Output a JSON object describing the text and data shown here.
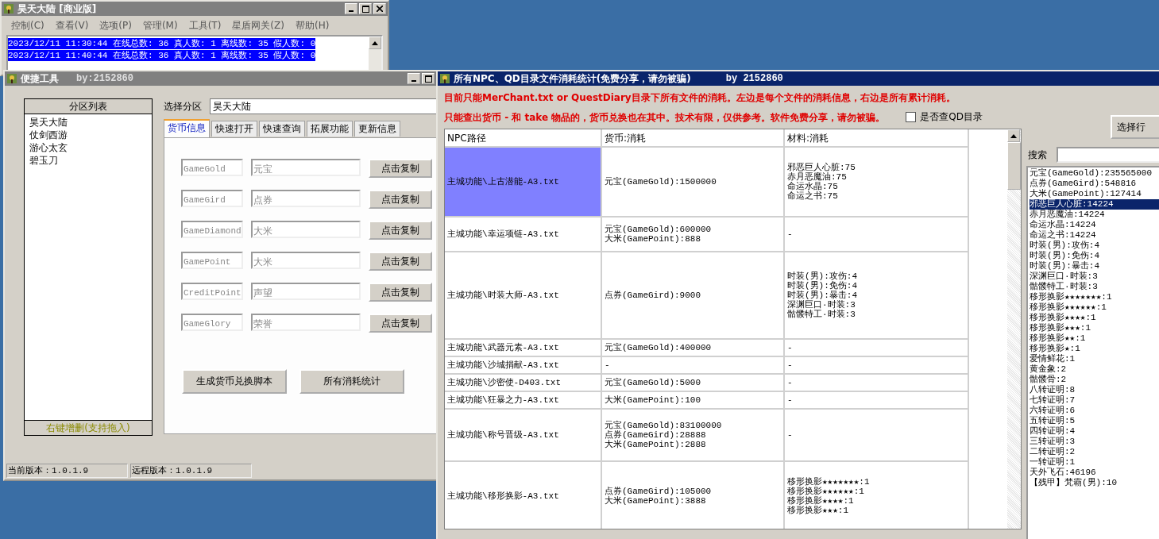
{
  "main_window": {
    "title": "昊天大陆 [商业版]",
    "menu": [
      "控制(C)",
      "查看(V)",
      "选项(P)",
      "管理(M)",
      "工具(T)",
      "星盾网关(Z)",
      "帮助(H)"
    ],
    "log": [
      {
        "text": "2023/12/11 11:30:44 在线总数: 36 真人数: 1 离线数: 35 假人数: 0",
        "selected": true
      },
      {
        "text": "2023/12/11 11:40:44 在线总数: 36 真人数: 1 离线数: 35 假人数: 0",
        "selected": true
      }
    ]
  },
  "tool_window": {
    "title": "便捷工具",
    "author": "by:2152860",
    "partition_list": {
      "header": "分区列表",
      "items": [
        {
          "label": "昊天大陆",
          "selected": false
        },
        {
          "label": "仗剑西游",
          "selected": false
        },
        {
          "label": "游心太玄",
          "selected": false
        },
        {
          "label": "碧玉刀",
          "selected": false
        }
      ],
      "footer": "右键增删(支持拖入)"
    },
    "partition_label": "选择分区",
    "partition_value": "昊天大陆",
    "tabs": [
      {
        "label": "货币信息",
        "selected": true
      },
      {
        "label": "快速打开",
        "selected": false
      },
      {
        "label": "快速查询",
        "selected": false
      },
      {
        "label": "拓展功能",
        "selected": false
      },
      {
        "label": "更新信息",
        "selected": false
      }
    ],
    "currency_rows": [
      {
        "key": "GameGold",
        "name": "元宝",
        "button": "点击复制"
      },
      {
        "key": "GameGird",
        "name": "点券",
        "button": "点击复制"
      },
      {
        "key": "GameDiamond",
        "name": "大米",
        "button": "点击复制"
      },
      {
        "key": "GamePoint",
        "name": "大米",
        "button": "点击复制"
      },
      {
        "key": "CreditPoint",
        "name": "声望",
        "button": "点击复制"
      },
      {
        "key": "GameGlory",
        "name": "荣誉",
        "button": "点击复制"
      }
    ],
    "actions": [
      "生成货币兑换脚本",
      "所有消耗统计"
    ],
    "status": [
      "当前版本：1.0.1.9",
      "远程版本：1.0.1.9"
    ]
  },
  "stats_window": {
    "title": "所有NPC、QD目录文件消耗统计(免费分享，请勿被骗)",
    "author": "by 2152860",
    "notices": [
      "目前只能MerChant.txt or QuestDiary目录下所有文件的消耗。左边是每个文件的消耗信息，右边是所有累计消耗。",
      "只能查出货币 - 和 take 物品的，货币兑换也在其中。技术有限，仅供参考。软件免费分享，请勿被骗。"
    ],
    "qd_checkbox": {
      "label": "是否查QD目录",
      "checked": false
    },
    "select_button": "选择行",
    "table": {
      "columns": [
        "NPC路径",
        "货币:消耗",
        "材料:消耗"
      ],
      "rows": [
        {
          "path": "主城功能\\上古潜能-A3.txt",
          "selected": true,
          "currency": [
            "元宝(GameGold):1500000"
          ],
          "materials": [
            "邪恶巨人心脏:75",
            "赤月恶魔油:75",
            "命运水晶:75",
            "命运之书:75"
          ]
        },
        {
          "path": "主城功能\\幸运项链-A3.txt",
          "selected": false,
          "currency": [
            "元宝(GameGold):600000",
            "大米(GamePoint):888"
          ],
          "materials": [
            "-"
          ]
        },
        {
          "path": "主城功能\\时装大师-A3.txt",
          "selected": false,
          "currency": [
            "点券(GameGird):9000"
          ],
          "materials": [
            "时装(男):攻伤:4",
            "时装(男):免伤:4",
            "时装(男):暴击:4",
            "深渊巨口·时装:3",
            "骷髅特工·时装:3"
          ]
        },
        {
          "path": "主城功能\\武器元素-A3.txt",
          "selected": false,
          "currency": [
            "元宝(GameGold):400000"
          ],
          "materials": [
            "-"
          ]
        },
        {
          "path": "主城功能\\沙城捐献-A3.txt",
          "selected": false,
          "currency": [
            "-"
          ],
          "materials": [
            "-"
          ]
        },
        {
          "path": "主城功能\\沙密使-D403.txt",
          "selected": false,
          "currency": [
            "元宝(GameGold):5000"
          ],
          "materials": [
            "-"
          ]
        },
        {
          "path": "主城功能\\狂暴之力-A3.txt",
          "selected": false,
          "currency": [
            "大米(GamePoint):100"
          ],
          "materials": [
            "-"
          ]
        },
        {
          "path": "主城功能\\称号晋级-A3.txt",
          "selected": false,
          "currency": [
            "元宝(GameGold):83100000",
            "点券(GameGird):28888",
            "大米(GamePoint):2888"
          ],
          "materials": [
            "-"
          ]
        },
        {
          "path": "主城功能\\移形换影-A3.txt",
          "selected": false,
          "currency": [
            "点券(GameGird):105000",
            "大米(GamePoint):3888"
          ],
          "materials": [
            "移形换影★★★★★★★:1",
            "移形换影★★★★★★:1",
            "移形换影★★★★:1",
            "移形换影★★★:1"
          ]
        }
      ]
    },
    "search": {
      "label": "搜索"
    },
    "totals": [
      {
        "text": "元宝(GameGold):235565000",
        "selected": false
      },
      {
        "text": "点券(GameGird):548816",
        "selected": false
      },
      {
        "text": "大米(GamePoint):127414",
        "selected": false
      },
      {
        "text": "邪恶巨人心脏:14224",
        "selected": true
      },
      {
        "text": "赤月恶魔油:14224",
        "selected": false
      },
      {
        "text": "命运水晶:14224",
        "selected": false
      },
      {
        "text": "命运之书:14224",
        "selected": false
      },
      {
        "text": "时装(男):攻伤:4",
        "selected": false
      },
      {
        "text": "时装(男):免伤:4",
        "selected": false
      },
      {
        "text": "时装(男):暴击:4",
        "selected": false
      },
      {
        "text": "深渊巨口·时装:3",
        "selected": false
      },
      {
        "text": "骷髅特工·时装:3",
        "selected": false
      },
      {
        "text": "移形换影★★★★★★★:1",
        "selected": false
      },
      {
        "text": "移形换影★★★★★★:1",
        "selected": false
      },
      {
        "text": "移形换影★★★★:1",
        "selected": false
      },
      {
        "text": "移形换影★★★:1",
        "selected": false
      },
      {
        "text": "移形换影★★:1",
        "selected": false
      },
      {
        "text": "移形换影★:1",
        "selected": false
      },
      {
        "text": "爱情鲜花:1",
        "selected": false
      },
      {
        "text": "黄金象:2",
        "selected": false
      },
      {
        "text": "骷髅骨:2",
        "selected": false
      },
      {
        "text": "八转证明:8",
        "selected": false
      },
      {
        "text": "七转证明:7",
        "selected": false
      },
      {
        "text": "六转证明:6",
        "selected": false
      },
      {
        "text": "五转证明:5",
        "selected": false
      },
      {
        "text": "四转证明:4",
        "selected": false
      },
      {
        "text": "三转证明:3",
        "selected": false
      },
      {
        "text": "二转证明:2",
        "selected": false
      },
      {
        "text": "一转证明:1",
        "selected": false
      },
      {
        "text": "天外飞石:46196",
        "selected": false
      },
      {
        "text": "【残甲】梵霸(男):10",
        "selected": false
      }
    ]
  }
}
